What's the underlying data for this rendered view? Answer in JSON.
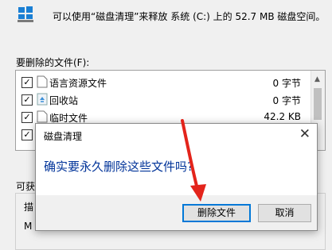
{
  "header": {
    "text": "可以使用“磁盘清理”来释放 系统 (C:) 上的 52.7 MB 磁盘空间。",
    "icon": "windows-drive-icon"
  },
  "files_label": "要删除的文件(F):",
  "files": [
    {
      "name": "语言资源文件",
      "size": "0 字节",
      "checked": true,
      "icon": "file-icon"
    },
    {
      "name": "回收站",
      "size": "0 字节",
      "checked": true,
      "icon": "recycle-bin-icon"
    },
    {
      "name": "临时文件",
      "size": "42.2 KB",
      "checked": true,
      "icon": "file-icon"
    },
    {
      "name": "",
      "size": "",
      "checked": true,
      "icon": "file-icon"
    }
  ],
  "gain_label": "可获",
  "desc_legend": "描",
  "desc_char": "M",
  "dialog": {
    "title": "磁盘清理",
    "message": "确实要永久删除这些文件吗?",
    "delete_button": "删除文件",
    "cancel_button": "取消",
    "close_glyph": "✕"
  },
  "colors": {
    "message": "#003399",
    "accent": "#0078d7",
    "annotation_arrow": "#e3241b"
  }
}
